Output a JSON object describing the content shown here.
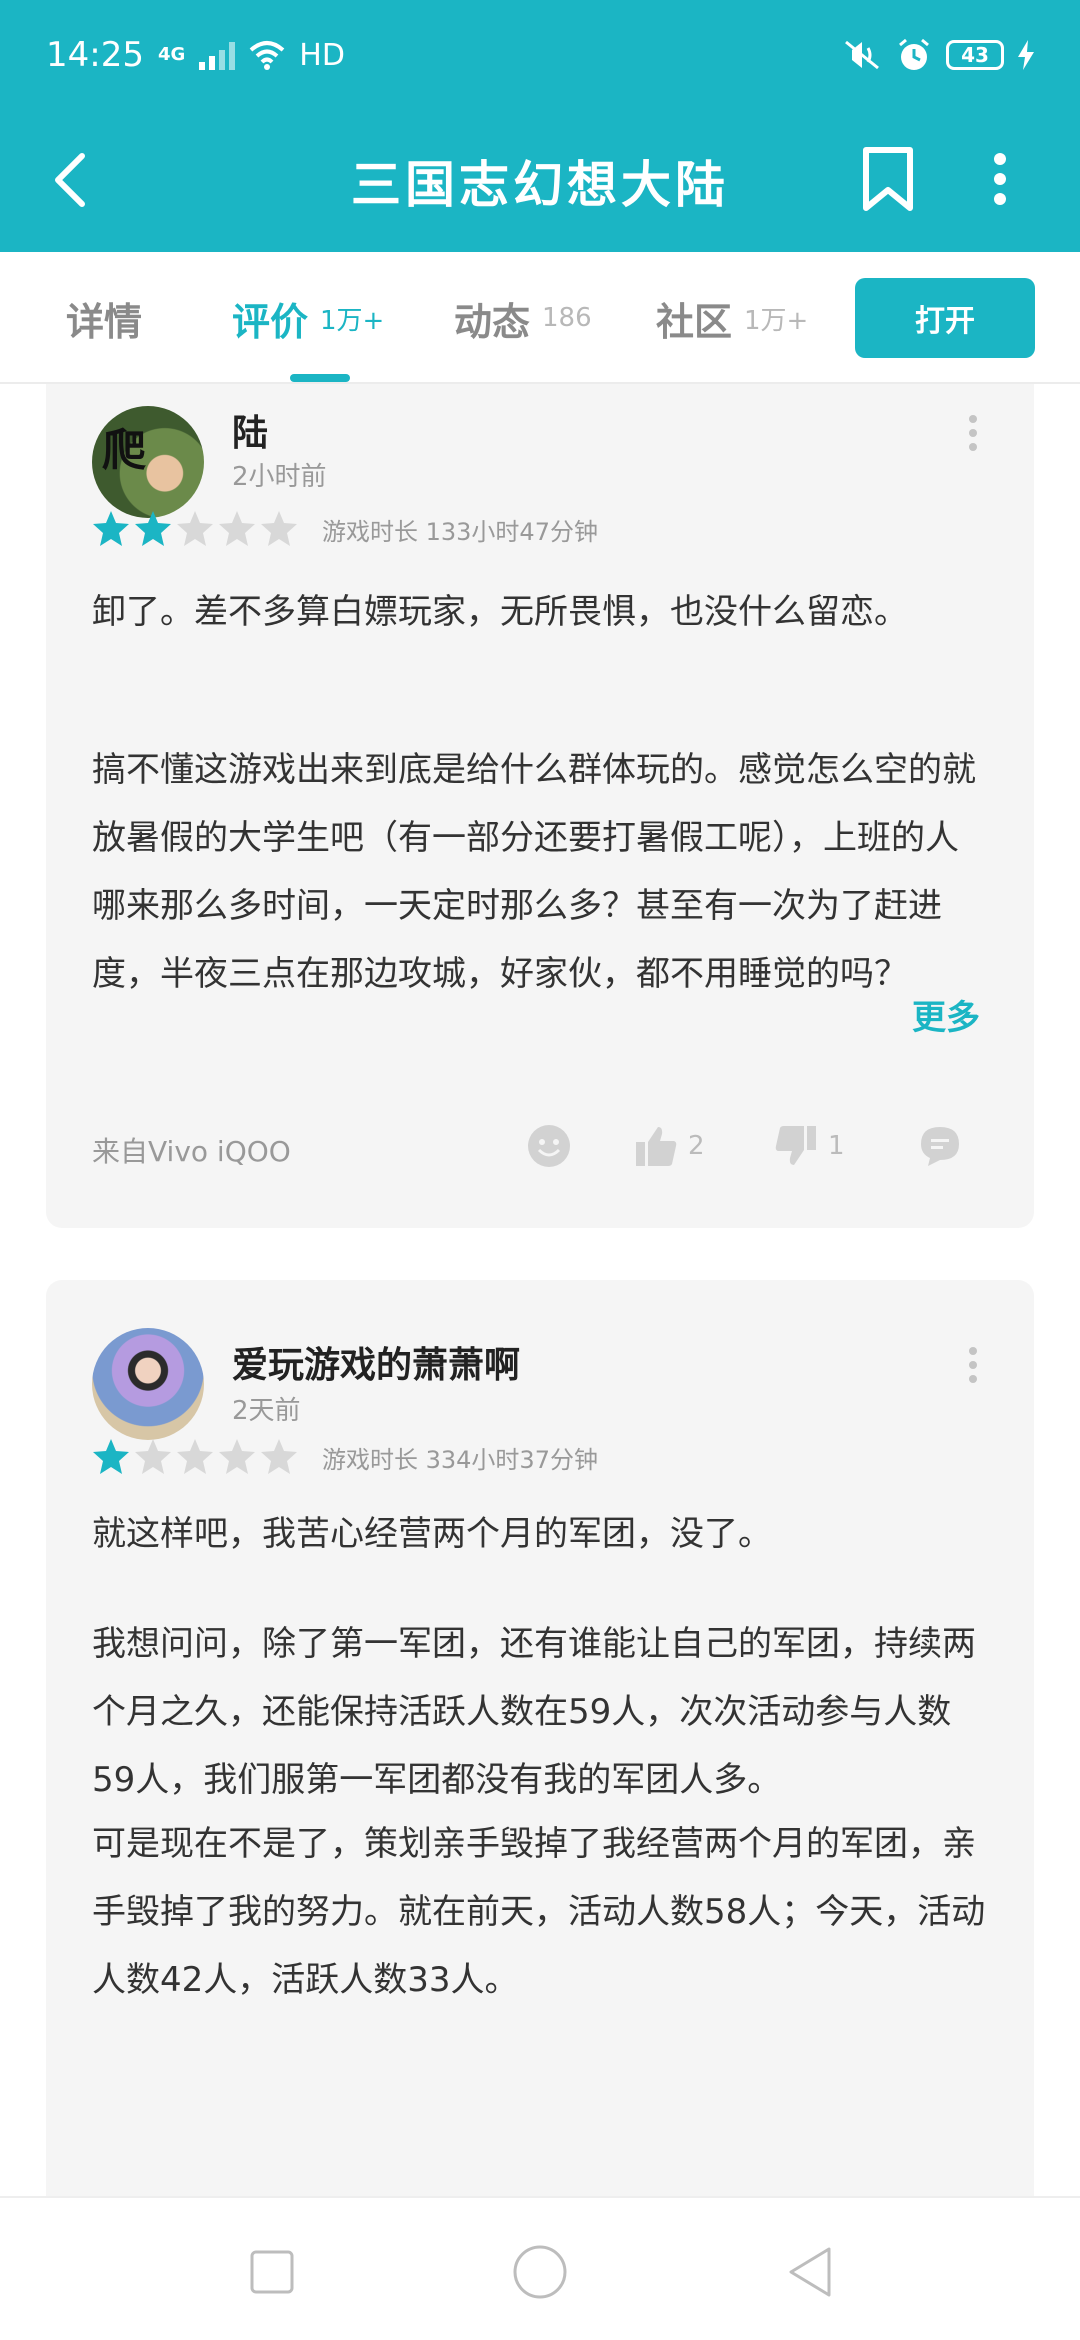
{
  "status_bar": {
    "time": "14:25",
    "network": "4G",
    "hd": "HD",
    "battery": "43"
  },
  "header": {
    "title": "三国志幻想大陆",
    "icons": [
      "back-arrow-icon",
      "bookmark-icon",
      "more-vertical-icon"
    ]
  },
  "tabs": [
    {
      "label": "详情",
      "count": ""
    },
    {
      "label": "评价",
      "count": "1万+",
      "active": true
    },
    {
      "label": "动态",
      "count": "186"
    },
    {
      "label": "社区",
      "count": "1万+"
    }
  ],
  "open_button": "打开",
  "colors": {
    "accent": "#1BB5C4",
    "card_bg": "#f5f5f5",
    "star_empty": "#d8d8d8",
    "muted_text": "#999999"
  },
  "reviews": [
    {
      "username": "陆",
      "time": "2小时前",
      "rating": 2,
      "max_rating": 5,
      "playtime": "游戏时长 133小时47分钟",
      "paragraphs": [
        "卸了。差不多算白嫖玩家，无所畏惧，也没什么留恋。",
        "搞不懂这游戏出来到底是给什么群体玩的。感觉怎么空的就放暑假的大学生吧（有一部分还要打暑假工呢），上班的人哪来那么多时间，一天定时那么多？甚至有一次为了赶进度，半夜三点在那边攻城，好家伙，都不用睡觉的吗？"
      ],
      "more_label": "更多",
      "device": "来自Vivo iQOO",
      "likes": "2",
      "dislikes": "1"
    },
    {
      "username": "爱玩游戏的萧萧啊",
      "time": "2天前",
      "rating": 1,
      "max_rating": 5,
      "playtime": "游戏时长 334小时37分钟",
      "paragraphs": [
        "就这样吧，我苦心经营两个月的军团，没了。",
        "我想问问，除了第一军团，还有谁能让自己的军团，持续两个月之久，还能保持活跃人数在59人，次次活动参与人数59人，我们服第一军团都没有我的军团人多。",
        "可是现在不是了，策划亲手毁掉了我经营两个月的军团，亲手毁掉了我的努力。就在前天，活动人数58人；今天，活动人数42人，活跃人数33人。"
      ]
    }
  ]
}
